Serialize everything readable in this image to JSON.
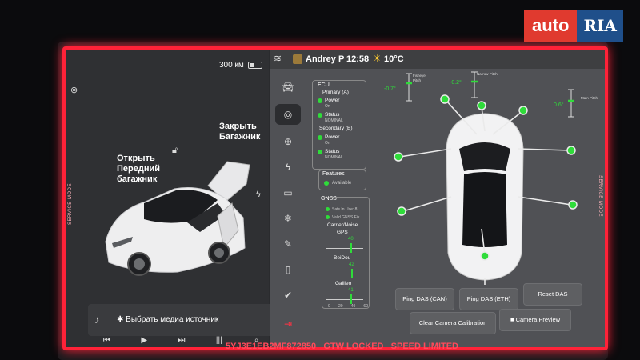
{
  "watermark": {
    "auto": "auto",
    "ria": "RIA"
  },
  "service_mode_label": "SERVICE MODE",
  "left_panel": {
    "range": "300 км",
    "front_trunk": "Открыть Передний багажник",
    "front_trunk_lines": [
      "Открыть",
      "Передний",
      "багажник"
    ],
    "rear_trunk_lines": [
      "Закрыть",
      "Багажник"
    ],
    "media_source": "Выбрать медиа источник"
  },
  "topbar": {
    "user": "Andrey P",
    "time": "12:58",
    "temperature": "10°C"
  },
  "ecu": {
    "title": "ECU",
    "primary": "Primary (A)",
    "secondary": "Secondary (B)",
    "power": "Power",
    "on": "On",
    "status": "Status",
    "nominal": "NOMINAL"
  },
  "features": {
    "title": "Features",
    "available": "Available"
  },
  "gnss": {
    "title": "GNSS",
    "sats": "Sats In Use: 8",
    "fix": "Valid GNSS Fix",
    "carrier": "Carrier/Noise",
    "gps": "GPS",
    "gps_value": 40,
    "beidou": "BeiDou",
    "beidou_value": 42,
    "galileo": "Galileo",
    "galileo_value": 41,
    "ticks": [
      "0",
      "20",
      "40",
      "60"
    ]
  },
  "cameras": {
    "fisheye": {
      "value": "-0.7°",
      "label": "Fisheye Pitch"
    },
    "narrow": {
      "value": "-0.2°",
      "label": "Narrow Pitch"
    },
    "main": {
      "value": "0.6°",
      "label": "Main Pitch"
    }
  },
  "buttons": {
    "ping_das_can": "Ping DAS (CAN)",
    "ping_das_eth": "Ping DAS (ETH)",
    "reset_das": "Reset DAS",
    "clear_camera_calibration": "Clear Camera Calibration",
    "camera_preview": "Camera Preview"
  },
  "bottom_bar": {
    "vin": "5YJ3E1EB2MF872850",
    "gtw": "GTW LOCKED",
    "speed": "SPEED LIMITED"
  },
  "colors": {
    "frame": "#ff2238",
    "status_green": "#2fdc3a"
  }
}
